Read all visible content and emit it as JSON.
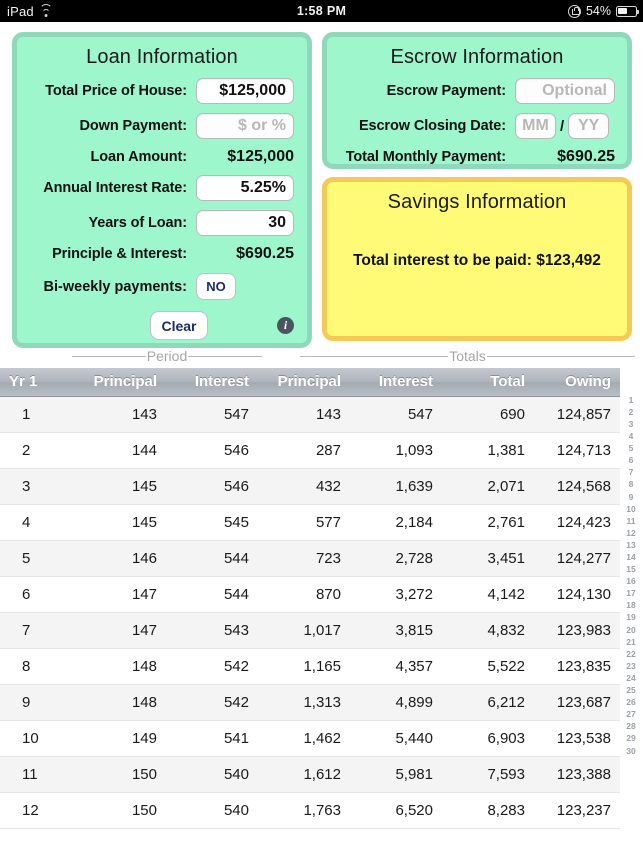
{
  "statusbar": {
    "carrier": "iPad",
    "wifi_icon": "wifi-icon",
    "time": "1:58 PM",
    "rotation_lock_icon": "rotation-lock-icon",
    "battery_percent": "54%",
    "battery_icon": "battery-icon"
  },
  "loan": {
    "title": "Loan Information",
    "total_price_label": "Total Price of House:",
    "total_price_value": "$125,000",
    "down_payment_label": "Down Payment:",
    "down_payment_placeholder": "$ or %",
    "loan_amount_label": "Loan Amount:",
    "loan_amount_value": "$125,000",
    "interest_rate_label": "Annual Interest Rate:",
    "interest_rate_value": "5.25%",
    "years_label": "Years of Loan:",
    "years_value": "30",
    "principle_interest_label": "Principle & Interest:",
    "principle_interest_value": "$690.25",
    "biweekly_label": "Bi-weekly payments:",
    "biweekly_value": "NO",
    "clear_label": "Clear",
    "info_glyph": "i"
  },
  "escrow": {
    "title": "Escrow Information",
    "payment_label": "Escrow Payment:",
    "payment_placeholder": "Optional",
    "closing_date_label": "Escrow Closing Date:",
    "closing_month_placeholder": "MM",
    "date_separator": "/",
    "closing_year_placeholder": "YY",
    "total_monthly_label": "Total Monthly Payment:",
    "total_monthly_value": "$690.25"
  },
  "savings": {
    "title": "Savings Information",
    "total_interest_line": "Total interest to be paid: $123,492"
  },
  "table": {
    "group_period": "Period",
    "group_totals": "Totals",
    "headers": [
      "Yr 1",
      "Principal",
      "Interest",
      "Principal",
      "Interest",
      "Total",
      "Owing"
    ],
    "rows": [
      [
        "1",
        "143",
        "547",
        "143",
        "547",
        "690",
        "124,857"
      ],
      [
        "2",
        "144",
        "546",
        "287",
        "1,093",
        "1,381",
        "124,713"
      ],
      [
        "3",
        "145",
        "546",
        "432",
        "1,639",
        "2,071",
        "124,568"
      ],
      [
        "4",
        "145",
        "545",
        "577",
        "2,184",
        "2,761",
        "124,423"
      ],
      [
        "5",
        "146",
        "544",
        "723",
        "2,728",
        "3,451",
        "124,277"
      ],
      [
        "6",
        "147",
        "544",
        "870",
        "3,272",
        "4,142",
        "124,130"
      ],
      [
        "7",
        "147",
        "543",
        "1,017",
        "3,815",
        "4,832",
        "123,983"
      ],
      [
        "8",
        "148",
        "542",
        "1,165",
        "4,357",
        "5,522",
        "123,835"
      ],
      [
        "9",
        "148",
        "542",
        "1,313",
        "4,899",
        "6,212",
        "123,687"
      ],
      [
        "10",
        "149",
        "541",
        "1,462",
        "5,440",
        "6,903",
        "123,538"
      ],
      [
        "11",
        "150",
        "540",
        "1,612",
        "5,981",
        "7,593",
        "123,388"
      ],
      [
        "12",
        "150",
        "540",
        "1,763",
        "6,520",
        "8,283",
        "123,237"
      ]
    ],
    "section_index": [
      "1",
      "2",
      "3",
      "4",
      "5",
      "6",
      "7",
      "8",
      "9",
      "10",
      "11",
      "12",
      "13",
      "14",
      "15",
      "16",
      "17",
      "18",
      "19",
      "20",
      "21",
      "22",
      "23",
      "24",
      "25",
      "26",
      "27",
      "28",
      "29",
      "30"
    ]
  },
  "colors": {
    "panel_green": "#9EF6CC",
    "panel_green_border": "#8FD9BA",
    "panel_yellow": "#FFFB77",
    "panel_yellow_border": "#F4C956",
    "header_gray": "#AEB5BC",
    "button_text": "#1B2A6B"
  }
}
